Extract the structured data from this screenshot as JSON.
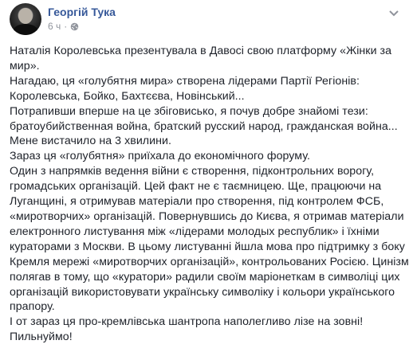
{
  "post": {
    "author": "Георгій Тука",
    "time": "6 ч",
    "separator": "·",
    "privacy_icon": "globe-icon",
    "menu_icon": "chevron-down-icon",
    "lines": [
      "Наталія Королевська презентувала в Давосі свою платформу «Жінки за",
      "мир».",
      "Нагадаю, ця «голубятня мира» створена лідерами Партії Регіонів:",
      "Королевська, Бойко, Бахтєєва, Новінський...",
      "Потрапивши вперше на це збіговисько, я почув добре знайомі тези:",
      "братоубийственная война, братский русский народ, гражданская война...",
      "Мене вистачило на 3 хвилини.",
      "Зараз ця «голубятня» приїхала до економічного форуму.",
      "Один з напрямків ведення війни є створення, підконтрольних ворогу,",
      "громадських організацій. Цей факт не є таємницею. Ще, працюючи на",
      "Луганщині, я отримував матеріали про створення, під контролем ФСБ,",
      "«миротворчих» організацій. Повернувшись до Києва, я отримав матеріали",
      "електронного листування між «лідерами молодых республик» і їхніми",
      "кураторами з Москви. В цьому листуванні йшла мова про підтримку з боку",
      "Кремля мережі «миротворчих організацій», контрольованих Росією. Цинізм",
      "полягав в тому, що «куратори» радили своїм маріонеткам в символіці цих",
      "організацій використовувати українську символіку і кольори українського",
      "прапору.",
      "І от зараз ця про-кремлівська шантропа наполегливо лізе на зовні!",
      "Пильнуймо!"
    ]
  },
  "colors": {
    "author": "#365899",
    "text": "#1d2129",
    "meta": "#90949c"
  }
}
